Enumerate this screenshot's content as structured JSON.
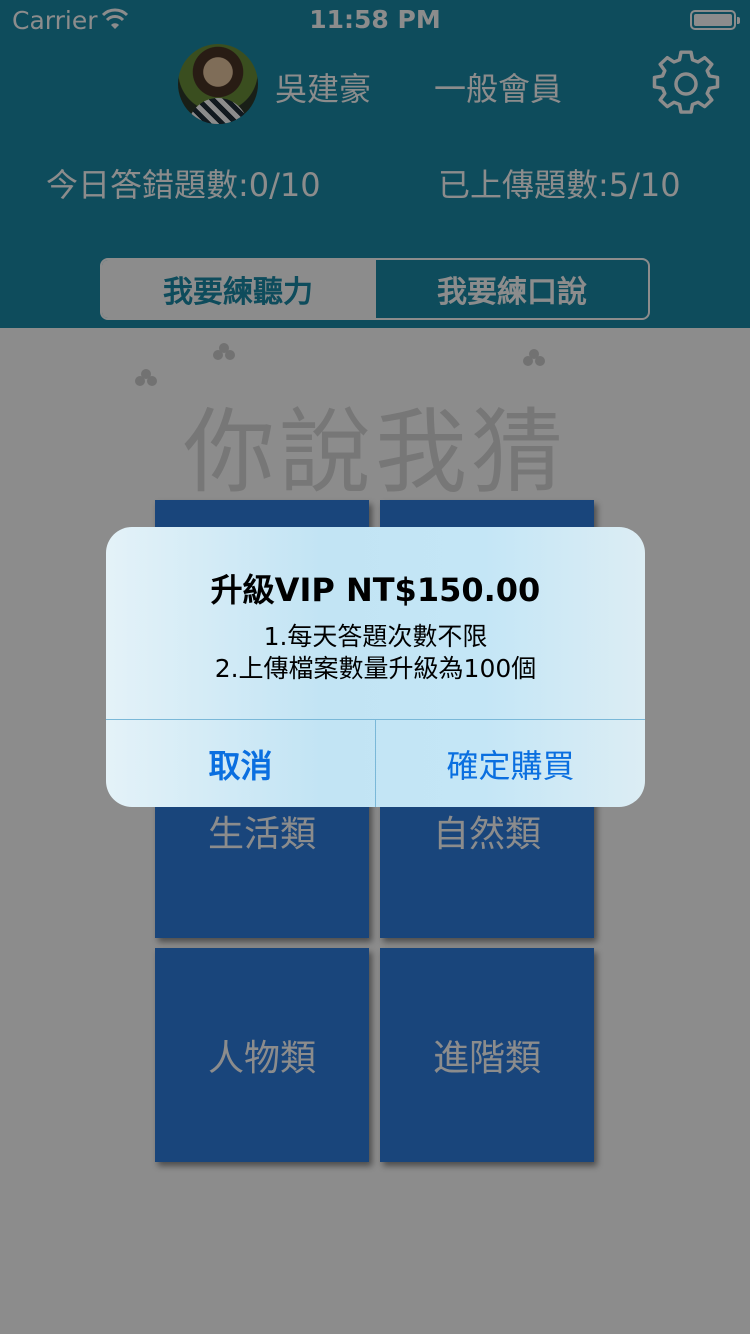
{
  "status_bar": {
    "carrier": "Carrier",
    "time": "11:58 PM"
  },
  "profile": {
    "name": "吳建豪",
    "membership": "一般會員"
  },
  "stats": {
    "wrong_today": "今日答錯題數:0/10",
    "uploaded": "已上傳題數:5/10"
  },
  "mode_tabs": [
    {
      "label": "我要練聽力",
      "selected": true
    },
    {
      "label": "我要練口說",
      "selected": false
    }
  ],
  "logo": {
    "text": "你說我猜"
  },
  "categories": [
    {
      "label": ""
    },
    {
      "label": ""
    },
    {
      "label": "生活類"
    },
    {
      "label": "自然類"
    },
    {
      "label": "人物類"
    },
    {
      "label": "進階類"
    }
  ],
  "alert": {
    "title": "升級VIP  NT$150.00",
    "line1": "1.每天答題次數不限",
    "line2": "2.上傳檔案數量升級為100個",
    "cancel_label": "取消",
    "confirm_label": "確定購買"
  },
  "colors": {
    "header": "#1a8aa8",
    "tile": "#2f7fe0",
    "alert_button_text": "#0a6fe0"
  },
  "icons": {
    "settings": "gear-icon",
    "wifi": "wifi-icon",
    "battery": "battery-icon"
  }
}
